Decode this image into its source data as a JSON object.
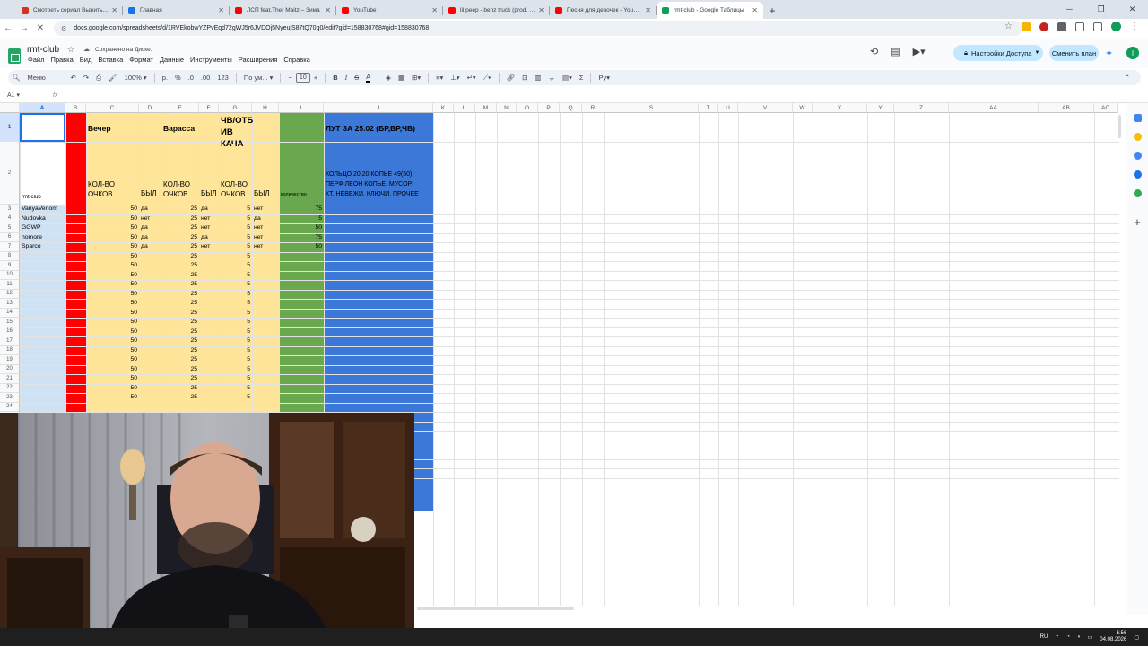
{
  "browser": {
    "tabs": [
      {
        "title": "Смотреть сериал Выжить любой ценой",
        "icon_color": "#d93025",
        "active": false
      },
      {
        "title": "Главная",
        "icon_color": "#1a73e8",
        "active": false
      },
      {
        "title": "ЛСП feat.Ther Maitz – Зима",
        "icon_color": "#ff0000",
        "active": false
      },
      {
        "title": "YouTube",
        "icon_color": "#ff0000",
        "active": false
      },
      {
        "title": "lil peep - benz truck (prod. sm...",
        "icon_color": "#ff0000",
        "active": false
      },
      {
        "title": "Песня для девочек - YouTube",
        "icon_color": "#ff0000",
        "active": false
      },
      {
        "title": "rmt-club - Google Таблицы",
        "icon_color": "#0f9d58",
        "active": true
      }
    ],
    "url": "docs.google.com/spreadsheets/d/1RVEkobwYZPvEqd72gWJ5r6JVDOj5NyeujS87tQ70g0/edit?gid=158830768#gid=158830768"
  },
  "sheets": {
    "doc_title": "rmt-club",
    "saved_status": "Сохранено на Диске.",
    "menus": [
      "Файл",
      "Правка",
      "Вид",
      "Вставка",
      "Формат",
      "Данные",
      "Инструменты",
      "Расширения",
      "Справка"
    ],
    "share_label": "Настройки Доступа",
    "plan_label": "Сменить план",
    "avatar_letter": "I"
  },
  "toolbar": {
    "menu_label": "Меню",
    "zoom": "100%",
    "currency": "р.",
    "percent": "%",
    "dec_less": ".0",
    "dec_more": ".00",
    "num_format": "123",
    "font": "По ум...",
    "font_size": "10",
    "bold": "B",
    "italic": "I",
    "strike": "S",
    "text_color": "A"
  },
  "formula_bar": {
    "cell_ref": "A1",
    "fx": "fx"
  },
  "columns": [
    "A",
    "B",
    "C",
    "D",
    "E",
    "F",
    "G",
    "H",
    "I",
    "J",
    "K",
    "L",
    "M",
    "N",
    "O",
    "P",
    "Q",
    "R",
    "S",
    "T",
    "U",
    "V",
    "W",
    "X",
    "Y",
    "Z",
    "AA",
    "AB",
    "AC"
  ],
  "header_row1": {
    "c": "Вечер",
    "e": "Варасса",
    "g_line1": "ЧВ/ОТБ",
    "g_line2": "ИВ",
    "g_line3": "КАЧА",
    "j": "ЛУТ ЗА 25.02 (БР,ВР,ЧВ)"
  },
  "header_row2": {
    "a": "rmt-club",
    "c_line1": "КОЛ-ВО",
    "c_line2": "ОЧКОВ",
    "d": "БЫЛ",
    "e_line1": "КОЛ-ВО",
    "e_line2": "ОЧКОВ",
    "f": "БЫЛ",
    "g_line1": "КОЛ-ВО",
    "g_line2": "ОЧКОВ",
    "h": "БЫЛ",
    "i": "количество",
    "j_line1": "КОЛЬЦО 20.20 КОПЬЕ 49(50),",
    "j_line2": "ПЕРФ ЛЕОН КОПЬЕ. МУСОР:",
    "j_line3": "КТ, НЕВЕЖИ, КЛЮЧИ, ПРОЧЕЕ"
  },
  "rows": [
    {
      "n": "3",
      "name": "VanyaVenom",
      "c": "50",
      "d": "да",
      "e": "25",
      "f": "да",
      "g": "5",
      "h": "нет",
      "i": "75"
    },
    {
      "n": "4",
      "name": "Nudovka",
      "c": "50",
      "d": "нет",
      "e": "25",
      "f": "нет",
      "g": "5",
      "h": "да",
      "i": "5"
    },
    {
      "n": "5",
      "name": "GGWP",
      "c": "50",
      "d": "да",
      "e": "25",
      "f": "нет",
      "g": "5",
      "h": "нет",
      "i": "50"
    },
    {
      "n": "6",
      "name": "nomore",
      "c": "50",
      "d": "да",
      "e": "25",
      "f": "да",
      "g": "5",
      "h": "нет",
      "i": "75"
    },
    {
      "n": "7",
      "name": "Sparco",
      "c": "50",
      "d": "да",
      "e": "25",
      "f": "нет",
      "g": "5",
      "h": "нет",
      "i": "50"
    },
    {
      "n": "8",
      "name": "",
      "c": "50",
      "d": "",
      "e": "25",
      "f": "",
      "g": "5",
      "h": "",
      "i": ""
    },
    {
      "n": "9",
      "name": "",
      "c": "50",
      "d": "",
      "e": "25",
      "f": "",
      "g": "5",
      "h": "",
      "i": ""
    },
    {
      "n": "10",
      "name": "",
      "c": "50",
      "d": "",
      "e": "25",
      "f": "",
      "g": "5",
      "h": "",
      "i": ""
    },
    {
      "n": "11",
      "name": "",
      "c": "50",
      "d": "",
      "e": "25",
      "f": "",
      "g": "5",
      "h": "",
      "i": ""
    },
    {
      "n": "12",
      "name": "",
      "c": "50",
      "d": "",
      "e": "25",
      "f": "",
      "g": "5",
      "h": "",
      "i": ""
    },
    {
      "n": "13",
      "name": "",
      "c": "50",
      "d": "",
      "e": "25",
      "f": "",
      "g": "5",
      "h": "",
      "i": ""
    },
    {
      "n": "14",
      "name": "",
      "c": "50",
      "d": "",
      "e": "25",
      "f": "",
      "g": "5",
      "h": "",
      "i": ""
    },
    {
      "n": "15",
      "name": "",
      "c": "50",
      "d": "",
      "e": "25",
      "f": "",
      "g": "5",
      "h": "",
      "i": ""
    },
    {
      "n": "16",
      "name": "",
      "c": "50",
      "d": "",
      "e": "25",
      "f": "",
      "g": "5",
      "h": "",
      "i": ""
    },
    {
      "n": "17",
      "name": "",
      "c": "50",
      "d": "",
      "e": "25",
      "f": "",
      "g": "5",
      "h": "",
      "i": ""
    },
    {
      "n": "18",
      "name": "",
      "c": "50",
      "d": "",
      "e": "25",
      "f": "",
      "g": "5",
      "h": "",
      "i": ""
    },
    {
      "n": "19",
      "name": "",
      "c": "50",
      "d": "",
      "e": "25",
      "f": "",
      "g": "5",
      "h": "",
      "i": ""
    },
    {
      "n": "20",
      "name": "",
      "c": "50",
      "d": "",
      "e": "25",
      "f": "",
      "g": "5",
      "h": "",
      "i": ""
    },
    {
      "n": "21",
      "name": "",
      "c": "50",
      "d": "",
      "e": "25",
      "f": "",
      "g": "5",
      "h": "",
      "i": ""
    },
    {
      "n": "22",
      "name": "",
      "c": "50",
      "d": "",
      "e": "25",
      "f": "",
      "g": "5",
      "h": "",
      "i": ""
    },
    {
      "n": "23",
      "name": "",
      "c": "50",
      "d": "",
      "e": "25",
      "f": "",
      "g": "5",
      "h": "",
      "i": ""
    }
  ],
  "colors": {
    "red_band": "#ff0000",
    "yellow_band": "#ffe599",
    "green_band": "#6aa84f",
    "blue_band": "#3c78d8",
    "name_col": "#cfe2f3"
  },
  "taskbar": {
    "lang": "RU",
    "time": "5:56",
    "date": "04.08.2026"
  }
}
